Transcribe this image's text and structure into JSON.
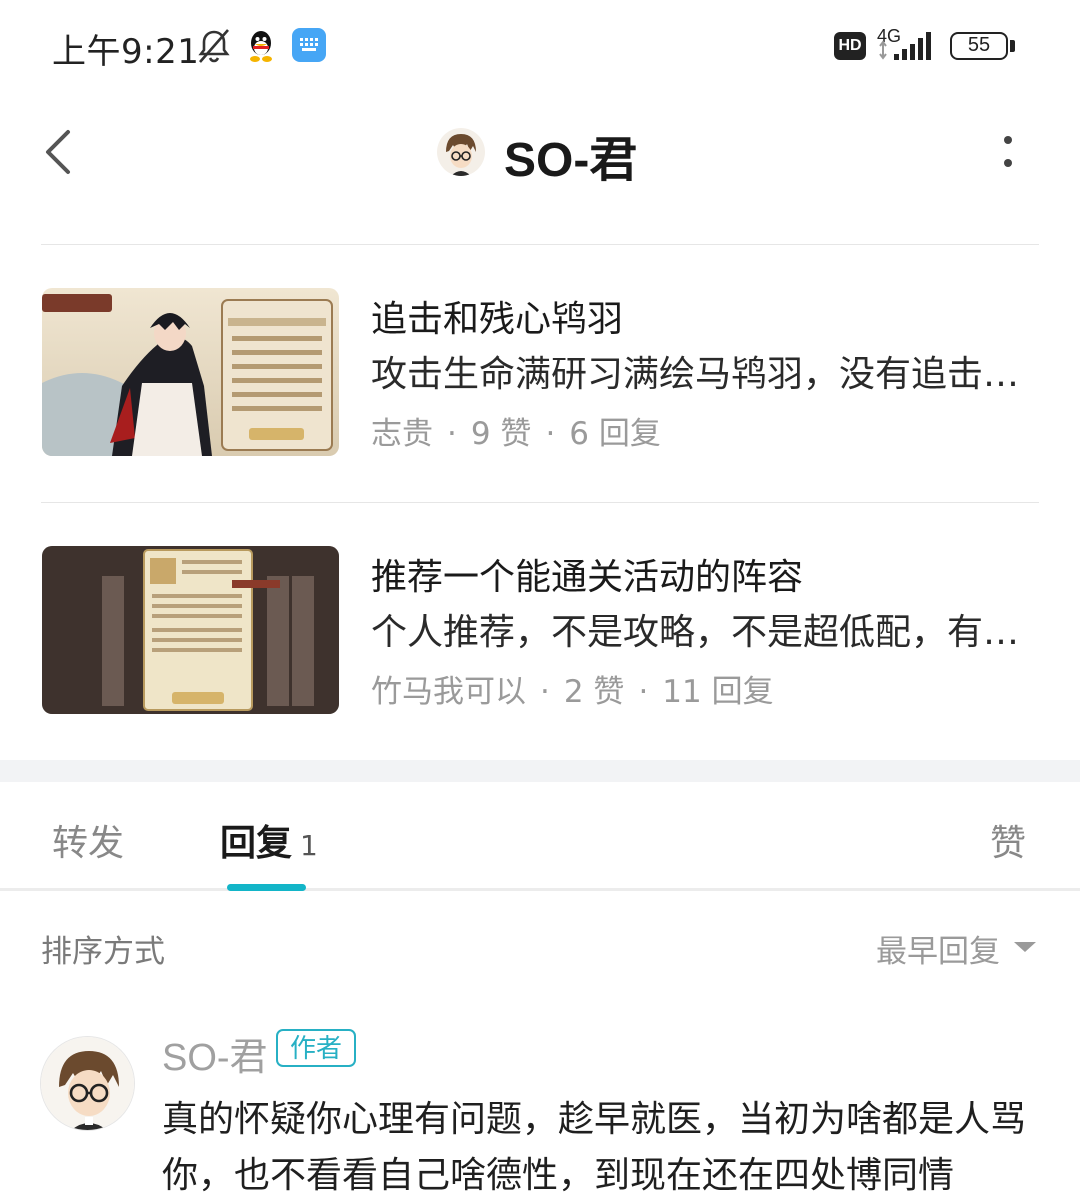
{
  "status_bar": {
    "time": "上午9:21",
    "hd_label": "HD",
    "network": "4G",
    "battery": "55",
    "icons": [
      "bell-off-icon",
      "qq-icon",
      "keyboard-icon",
      "hd-icon",
      "signal-icon",
      "battery-icon"
    ]
  },
  "header": {
    "title": "SO-君",
    "back_icon": "chevron-left-icon",
    "more_icon": "more-vertical-icon"
  },
  "posts": [
    {
      "title": "追击和残心鸨羽",
      "excerpt": "攻击生命满研习满绘马鸨羽，没有追击和残心的高伤害选择",
      "author": "志贵",
      "likes": "9 赞",
      "replies": "6 回复"
    },
    {
      "title": "推荐一个能通关活动的阵容",
      "excerpt": "个人推荐，不是攻略，不是超低配，有需要的可以参考一下",
      "author": "竹马我可以",
      "likes": "2 赞",
      "replies": "11 回复"
    }
  ],
  "separator": "·",
  "tabs": {
    "repost": "转发",
    "reply": "回复",
    "reply_count": "1",
    "like": "赞"
  },
  "sort": {
    "label": "排序方式",
    "value": "最早回复"
  },
  "reply": {
    "author": "SO-君",
    "badge": "作者",
    "text": "真的怀疑你心理有问题，趁早就医，当初为啥都是人骂你，也不看看自己啥德性，到现在还在四处博同情"
  },
  "colors": {
    "accent": "#13b5c8",
    "badge": "#27b0c4",
    "meta_gray": "#9a9a9a"
  }
}
